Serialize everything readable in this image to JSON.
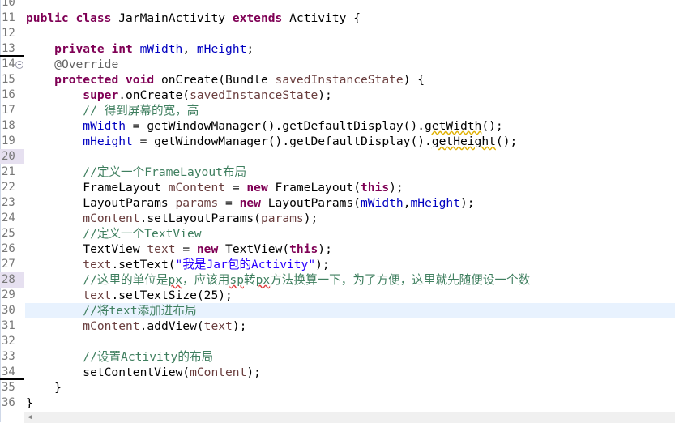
{
  "editor": {
    "current_line": 30,
    "lines": [
      {
        "n": "10",
        "tokens": []
      },
      {
        "n": "11",
        "tokens": [
          [
            "public class ",
            "kw"
          ],
          [
            "JarMainActivity ",
            ""
          ],
          [
            "extends ",
            "kw"
          ],
          [
            "Activity {",
            ""
          ]
        ]
      },
      {
        "n": "12",
        "tokens": []
      },
      {
        "n": "13",
        "underline": true,
        "tokens": [
          [
            "    ",
            ""
          ],
          [
            "private int ",
            "kw"
          ],
          [
            "mWidth",
            "fld"
          ],
          [
            ", ",
            ""
          ],
          [
            "mHeight",
            "fld"
          ],
          [
            ";",
            ""
          ]
        ]
      },
      {
        "n": "14",
        "fold": true,
        "tokens": [
          [
            "    ",
            ""
          ],
          [
            "@Override",
            "ann"
          ]
        ]
      },
      {
        "n": "15",
        "tokens": [
          [
            "    ",
            ""
          ],
          [
            "protected void ",
            "kw"
          ],
          [
            "onCreate(Bundle ",
            ""
          ],
          [
            "savedInstanceState",
            "prm"
          ],
          [
            ") {",
            ""
          ]
        ]
      },
      {
        "n": "16",
        "tokens": [
          [
            "        ",
            ""
          ],
          [
            "super",
            "kw"
          ],
          [
            ".onCreate(",
            ""
          ],
          [
            "savedInstanceState",
            "prm"
          ],
          [
            ");",
            ""
          ]
        ]
      },
      {
        "n": "17",
        "tokens": [
          [
            "        ",
            ""
          ],
          [
            "// 得到屏幕的宽，高",
            "cm"
          ]
        ]
      },
      {
        "n": "18",
        "tokens": [
          [
            "        ",
            ""
          ],
          [
            "mWidth",
            "fld"
          ],
          [
            " = getWindowManager().getDefaultDisplay().",
            ""
          ],
          [
            "getWidth",
            "dep warn"
          ],
          [
            "();",
            ""
          ]
        ]
      },
      {
        "n": "19",
        "tokens": [
          [
            "        ",
            ""
          ],
          [
            "mHeight",
            "fld"
          ],
          [
            " = getWindowManager().getDefaultDisplay().",
            ""
          ],
          [
            "getHeight",
            "dep warn"
          ],
          [
            "();",
            ""
          ]
        ]
      },
      {
        "n": "20",
        "mark": true,
        "tokens": []
      },
      {
        "n": "21",
        "tokens": [
          [
            "        ",
            ""
          ],
          [
            "//定义一个FrameLayout布局",
            "cm"
          ]
        ]
      },
      {
        "n": "22",
        "tokens": [
          [
            "        FrameLayout ",
            ""
          ],
          [
            "mContent",
            "prm"
          ],
          [
            " = ",
            ""
          ],
          [
            "new ",
            "kw"
          ],
          [
            "FrameLayout(",
            ""
          ],
          [
            "this",
            "kw"
          ],
          [
            ");",
            ""
          ]
        ]
      },
      {
        "n": "23",
        "tokens": [
          [
            "        LayoutParams ",
            ""
          ],
          [
            "params",
            "prm"
          ],
          [
            " = ",
            ""
          ],
          [
            "new ",
            "kw"
          ],
          [
            "LayoutParams(",
            ""
          ],
          [
            "mWidth",
            "fld"
          ],
          [
            ",",
            ""
          ],
          [
            "mHeight",
            "fld"
          ],
          [
            ");",
            ""
          ]
        ]
      },
      {
        "n": "24",
        "tokens": [
          [
            "        ",
            ""
          ],
          [
            "mContent",
            "prm"
          ],
          [
            ".setLayoutParams(",
            ""
          ],
          [
            "params",
            "prm"
          ],
          [
            ");",
            ""
          ]
        ]
      },
      {
        "n": "25",
        "tokens": [
          [
            "        ",
            ""
          ],
          [
            "//定义一个TextView",
            "cm"
          ]
        ]
      },
      {
        "n": "26",
        "tokens": [
          [
            "        TextView ",
            ""
          ],
          [
            "text",
            "prm"
          ],
          [
            " = ",
            ""
          ],
          [
            "new ",
            "kw"
          ],
          [
            "TextView(",
            ""
          ],
          [
            "this",
            "kw"
          ],
          [
            ");",
            ""
          ]
        ]
      },
      {
        "n": "27",
        "tokens": [
          [
            "        ",
            ""
          ],
          [
            "text",
            "prm"
          ],
          [
            ".setText(",
            ""
          ],
          [
            "\"我是Jar包的Activity\"",
            "str"
          ],
          [
            ");",
            ""
          ]
        ]
      },
      {
        "n": "28",
        "mark": true,
        "tokens": [
          [
            "        ",
            ""
          ],
          [
            "//这里的单位是",
            "cm"
          ],
          [
            "px",
            "cm err"
          ],
          [
            "，应该用",
            "cm"
          ],
          [
            "sp",
            "cm err"
          ],
          [
            "转",
            "cm"
          ],
          [
            "px",
            "cm err"
          ],
          [
            "方法换算一下，为了方便，这里就先随便设一个数",
            "cm"
          ]
        ]
      },
      {
        "n": "29",
        "tokens": [
          [
            "        ",
            ""
          ],
          [
            "text",
            "prm"
          ],
          [
            ".setTextSize(25);",
            ""
          ]
        ]
      },
      {
        "n": "30",
        "tokens": [
          [
            "        ",
            ""
          ],
          [
            "//将text添加进布局",
            "cm"
          ]
        ]
      },
      {
        "n": "31",
        "tokens": [
          [
            "        ",
            ""
          ],
          [
            "mContent",
            "prm"
          ],
          [
            ".addView(",
            ""
          ],
          [
            "text",
            "prm"
          ],
          [
            ");",
            ""
          ]
        ]
      },
      {
        "n": "32",
        "tokens": []
      },
      {
        "n": "33",
        "tokens": [
          [
            "        ",
            ""
          ],
          [
            "//设置Activity的布局",
            "cm"
          ]
        ]
      },
      {
        "n": "34",
        "underline": true,
        "tokens": [
          [
            "        setContentView(",
            ""
          ],
          [
            "mContent",
            "prm"
          ],
          [
            ");",
            ""
          ]
        ]
      },
      {
        "n": "35",
        "tokens": [
          [
            "    }",
            ""
          ]
        ]
      },
      {
        "n": "36",
        "tokens": [
          [
            "}",
            ""
          ]
        ]
      }
    ]
  },
  "scrollbar": {
    "left_arrow_icon": "chevron-left-icon"
  }
}
